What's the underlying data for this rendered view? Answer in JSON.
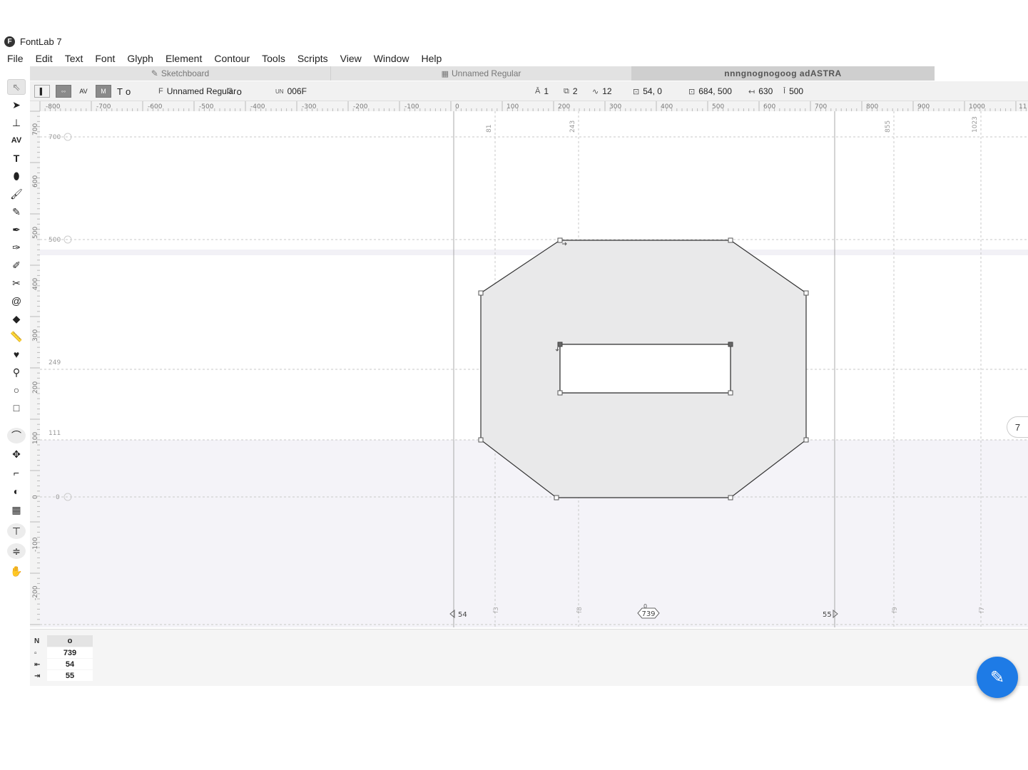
{
  "app": {
    "title": "FontLab 7",
    "logo": "F"
  },
  "menu": [
    "File",
    "Edit",
    "Text",
    "Font",
    "Glyph",
    "Element",
    "Contour",
    "Tools",
    "Scripts",
    "View",
    "Window",
    "Help"
  ],
  "tabs": [
    {
      "label": "Sketchboard",
      "icon": "pen-icon"
    },
    {
      "label": "Unnamed Regular",
      "icon": "grid-icon"
    },
    {
      "label": "nnngnognogoog adASTRA",
      "icon": ""
    }
  ],
  "props": {
    "glyph_ab": "T",
    "glyph_name": "o",
    "font_prefix": "F",
    "font_name": "Unnamed Regular",
    "font_glyph_prefix": "G",
    "font_glyph": "o",
    "unicode_prefix": "UN",
    "unicode": "006F",
    "layers": "1",
    "contours": "2",
    "nodes": "12",
    "origin": "54, 0",
    "size": "684, 500",
    "width": "630",
    "height": "500"
  },
  "ruler": {
    "h_labels": [
      "-800",
      "-700",
      "-600",
      "-500",
      "-400",
      "-300",
      "-200",
      "-100",
      "0",
      "100",
      "200",
      "300",
      "400",
      "500",
      "600",
      "700",
      "800",
      "900",
      "1000",
      "11"
    ],
    "v_labels": [
      "700",
      "600",
      "500",
      "400",
      "300",
      "200",
      "100",
      "0",
      "-100",
      "-200"
    ]
  },
  "guides": {
    "v_top": [
      "81",
      "243",
      "855",
      "1023"
    ],
    "v_bottom": [
      "f3",
      "f8",
      "f9",
      "f7"
    ],
    "h": [
      "700",
      "500",
      "249",
      "111",
      "0"
    ]
  },
  "metrics_overlay": {
    "lsb": "54",
    "advance": "739",
    "rsb": "55",
    "origin_mark": "0"
  },
  "side_tab": "7",
  "metrics_panel": {
    "header_label": "N",
    "glyph": "o",
    "rows": [
      {
        "icon": "advance-icon",
        "value": "739"
      },
      {
        "icon": "lsb-icon",
        "value": "54"
      },
      {
        "icon": "rsb-icon",
        "value": "55"
      }
    ]
  },
  "colors": {
    "fab": "#1e7be6",
    "glyph_fill": "#e9e9ea",
    "overshoot_band": "#f4f3f8"
  }
}
